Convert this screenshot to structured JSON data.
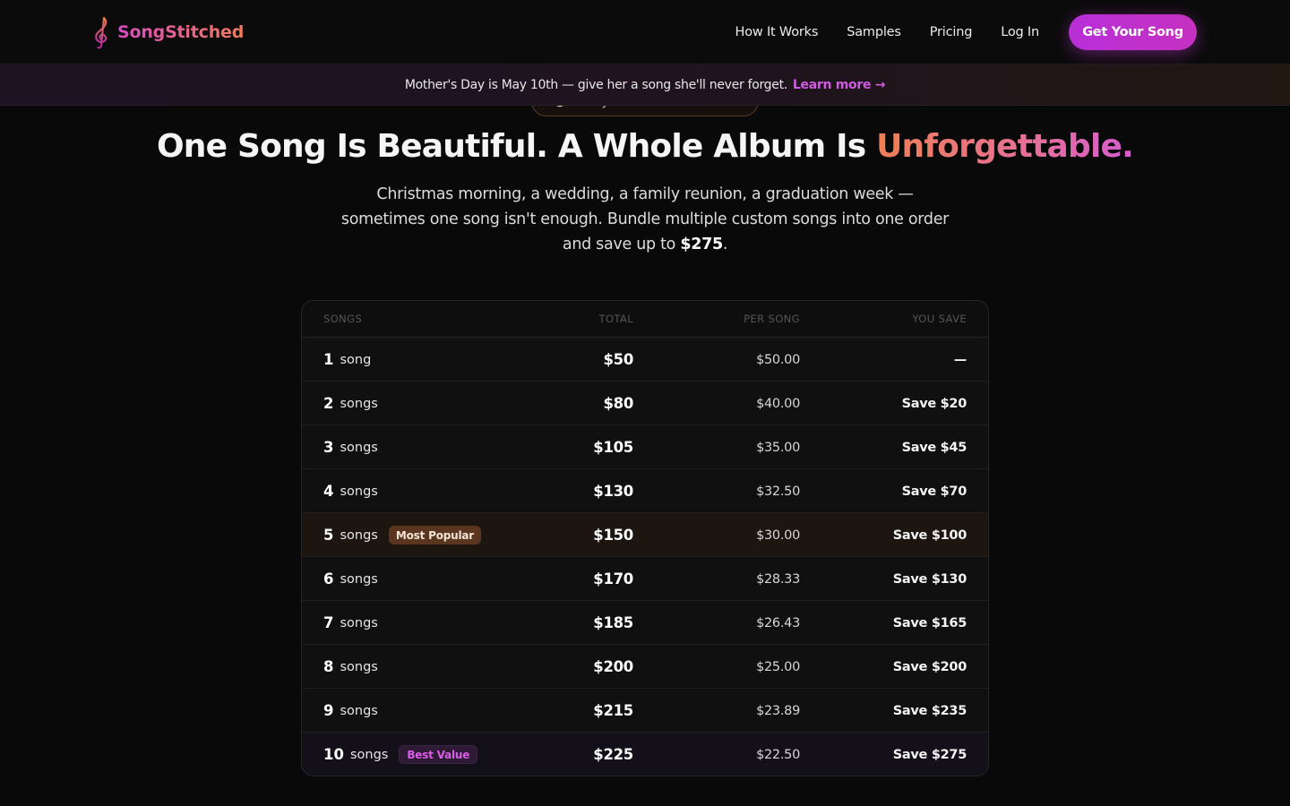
{
  "nav": {
    "brand": "SongStitched",
    "links": [
      "How It Works",
      "Samples",
      "Pricing",
      "Log In"
    ],
    "cta_label": "Get Your Song",
    "brand_icon": "treble-clef-icon"
  },
  "promo": {
    "text": "Mother's Day is May 10th — give her a song she'll never forget.",
    "link_label": "Learn more →"
  },
  "hero": {
    "pill_label": "Family & Friends Album Bundle",
    "title_main": "One Song Is Beautiful. A Whole Album Is ",
    "title_accent": "Unforgettable.",
    "subtitle_text": "Christmas morning, a wedding, a family reunion, a graduation week — sometimes one song isn't enough. Bundle multiple custom songs into one order and save up to ",
    "subtitle_amount": "$275",
    "subtitle_end": "."
  },
  "table": {
    "headers": [
      "SONGS",
      "TOTAL",
      "PER SONG",
      "YOU SAVE"
    ],
    "rows": [
      {
        "count": "1",
        "unit": "song",
        "total": "$50",
        "per": "$50.00",
        "save": "—",
        "badge": ""
      },
      {
        "count": "2",
        "unit": "songs",
        "total": "$80",
        "per": "$40.00",
        "save": "Save $20",
        "badge": ""
      },
      {
        "count": "3",
        "unit": "songs",
        "total": "$105",
        "per": "$35.00",
        "save": "Save $45",
        "badge": ""
      },
      {
        "count": "4",
        "unit": "songs",
        "total": "$130",
        "per": "$32.50",
        "save": "Save $70",
        "badge": ""
      },
      {
        "count": "5",
        "unit": "songs",
        "total": "$150",
        "per": "$30.00",
        "save": "Save $100",
        "badge": "Most Popular"
      },
      {
        "count": "6",
        "unit": "songs",
        "total": "$170",
        "per": "$28.33",
        "save": "Save $130",
        "badge": ""
      },
      {
        "count": "7",
        "unit": "songs",
        "total": "$185",
        "per": "$26.43",
        "save": "Save $165",
        "badge": ""
      },
      {
        "count": "8",
        "unit": "songs",
        "total": "$200",
        "per": "$25.00",
        "save": "Save $200",
        "badge": ""
      },
      {
        "count": "9",
        "unit": "songs",
        "total": "$215",
        "per": "$23.89",
        "save": "Save $235",
        "badge": ""
      },
      {
        "count": "10",
        "unit": "songs",
        "total": "$225",
        "per": "$22.50",
        "save": "Save $275",
        "badge": "Best Value"
      }
    ]
  },
  "colors": {
    "background": "#0a0909",
    "accent_purple": "#c531c0",
    "accent_orange": "#f07f55",
    "badge_popular": "#5a3520",
    "badge_best": "#2e1a35"
  }
}
